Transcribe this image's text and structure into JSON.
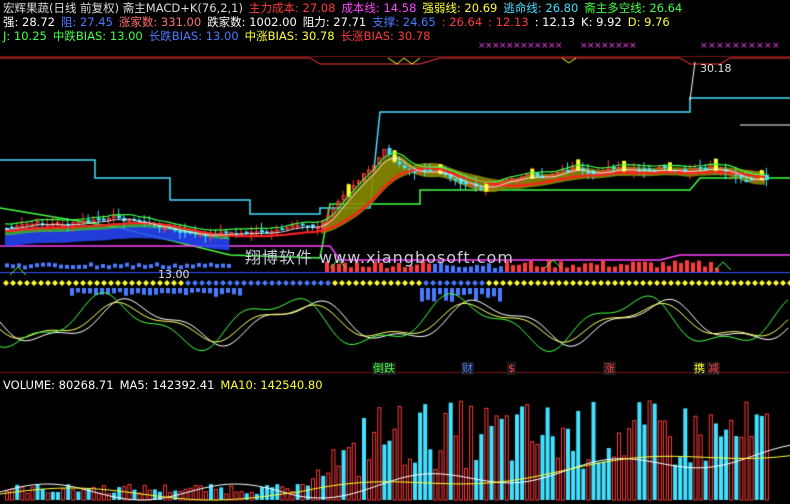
{
  "header": {
    "line1": [
      {
        "text": "宏辉果蔬(日线 前复权) 斋主MACD+K(76,2,1)",
        "color": "#dcdcdc"
      },
      {
        "text": "主力成本: 27.08",
        "color": "#ff3b3b"
      },
      {
        "text": "成本线: 14.58",
        "color": "#ff44ff"
      },
      {
        "text": "强弱线: 20.69",
        "color": "#ffff33"
      },
      {
        "text": "逃命线: 26.80",
        "color": "#44e0ff"
      },
      {
        "text": "斋主多空线: 26.64",
        "color": "#44ff44"
      }
    ],
    "line2": [
      {
        "text": "强: 28.72",
        "color": "#ffffff"
      },
      {
        "text": "阻: 27.45",
        "color": "#4a7bff"
      },
      {
        "text": "涨家数: 331.00",
        "color": "#ff7070"
      },
      {
        "text": "跌家数: 1002.00",
        "color": "#ffffff"
      },
      {
        "text": "阻力: 27.71",
        "color": "#ffffff"
      },
      {
        "text": "支撑: 24.65",
        "color": "#4a7bff"
      },
      {
        "text": ": 26.64",
        "color": "#ff3b3b"
      },
      {
        "text": ": 12.13",
        "color": "#ff3b3b"
      },
      {
        "text": ": 12.13",
        "color": "#ffffff"
      },
      {
        "text": "K: 9.92",
        "color": "#ffffff"
      },
      {
        "text": "D: 9.76",
        "color": "#ffff33"
      }
    ],
    "line3": [
      {
        "text": "J: 10.25",
        "color": "#44ff44"
      },
      {
        "text": "中跌BIAS: 13.00",
        "color": "#44ff44"
      },
      {
        "text": "长跌BIAS: 13.00",
        "color": "#4a7bff"
      },
      {
        "text": "中涨BIAS: 30.78",
        "color": "#ffff33"
      },
      {
        "text": "长涨BIAS: 30.78",
        "color": "#ff3b3b"
      }
    ]
  },
  "annotations": {
    "high_label": "30.18",
    "low_label": "13.00"
  },
  "watermark": "翔博软件 www.xiangbosoft.com",
  "events": [
    {
      "text": "倒跌",
      "color": "#44ff44"
    },
    {
      "text": "财",
      "color": "#4a7bff"
    },
    {
      "text": "$",
      "color": "#ff3b3b"
    },
    {
      "text": "涨",
      "color": "#ff3b3b"
    },
    {
      "text": "携",
      "color": "#ffff33"
    },
    {
      "text": "减",
      "color": "#ff3b3b"
    }
  ],
  "volume_header": [
    {
      "text": "VOLUME: 80268.71",
      "color": "#ffffff"
    },
    {
      "text": "MA5: 142392.41",
      "color": "#ffffff"
    },
    {
      "text": "MA10: 142540.80",
      "color": "#ffff33"
    }
  ],
  "colors": {
    "up": "#ff3b3b",
    "down": "#44e0ff",
    "olive": "#8a8a00",
    "green": "#44ff44",
    "cyan": "#44e0ff",
    "magenta": "#ff44ff",
    "blue": "#4a7bff",
    "yellow": "#ffff33"
  }
}
